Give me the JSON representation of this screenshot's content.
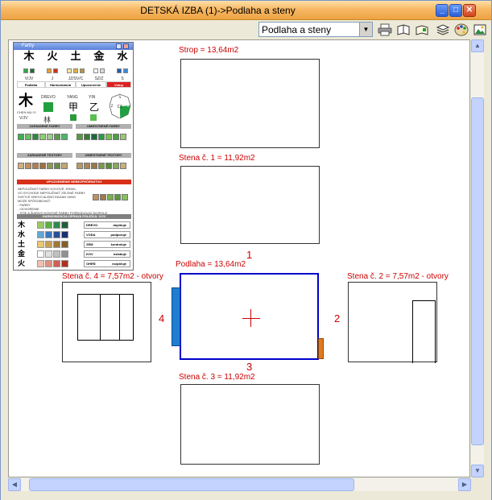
{
  "window": {
    "title": "DETSKÁ IZBA (1)->Podlaha a steny"
  },
  "toolbar": {
    "view_select": "Podlaha a steny",
    "icons": [
      "printer-icon",
      "book-icon",
      "book-open-icon",
      "layers-icon",
      "palette-icon",
      "image-icon"
    ]
  },
  "plan": {
    "strop_label": "Strop = 13,64m2",
    "stena1_label": "Stena č. 1 = 11,92m2",
    "podlaha_label": "Podlaha = 13,64m2",
    "stena4_label": "Stena č. 4 = 7,57m2 - otvory",
    "stena2_label": "Stena č. 2 = 7,57m2 - otvory",
    "stena3_label": "Stena č. 3 = 11,92m2",
    "num1": "1",
    "num2": "2",
    "num3": "3",
    "num4": "4",
    "floor_border_color": "#0000cc",
    "wall4_fill": "#1e7fd0",
    "wall2_fill": "#e07a20"
  },
  "palette": {
    "title": "Farby",
    "elements": [
      {
        "char": "木",
        "dir": "V/JV",
        "colors": [
          "#2ea84a",
          "#1a6e30"
        ]
      },
      {
        "char": "火",
        "dir": "J",
        "colors": [
          "#e8a030",
          "#d03020"
        ]
      },
      {
        "char": "土",
        "dir": "JZ/SV/C",
        "colors": [
          "#f2e8a0",
          "#e0b040",
          "#c09040"
        ]
      },
      {
        "char": "金",
        "dir": "SZ/Z",
        "colors": [
          "#ffffff",
          "#d8d8d8"
        ]
      },
      {
        "char": "水",
        "dir": "S",
        "colors": [
          "#1e5eb0",
          "#3a8ad8"
        ]
      }
    ],
    "tabs": [
      "Podlaha",
      "Harmonizácia",
      "Upozornenie",
      "Vstup"
    ],
    "big_char": "木",
    "big_char_sub": "CHEN MU.YI",
    "drevo": "DREVO",
    "yang": "YANG",
    "yin": "YIN",
    "dir_bottom": "V/JV",
    "compass": [
      "J",
      "JZ",
      "Z",
      "SZ",
      "S",
      "SV",
      "V",
      "JV",
      "C5"
    ],
    "sec_zariadene_farby": "ZARIADENÉ FARBY",
    "sec_umiestnene_farby": "UMIESTNENÉ FARBY",
    "sec_zariadene_textury": "ZARIADENÉ TEXTÚRY",
    "sec_umiestnene_textury": "UMIESTNENÉ TEXTÚRY",
    "sec_upozornenie": "UPOZORNENIE NEBEZPEČENSTVO",
    "warn_lines": [
      "NEPOUŽÍVAŤ FARBY KOVOVÉ, KRAKL",
      "VO SYCHODE NEPOUŽÍVAŤ ZELENÉ FARBY",
      "SVETLÉ DREVO ALEBO RADAN YANG",
      "MOŽE SPÔSOBOVAŤ:",
      " - FARBY",
      " - OCHORENIE",
      " - STIE A ŽIARIVO KOVOVÉ FARBY POŠKODZUJÚ DIOPOLE"
    ],
    "sec_harmonizacia": "HARMONIZÁCIA ÚPRAVA POLIČKA: V/JV",
    "harm_rows": [
      {
        "char": "木",
        "name": "DREVO",
        "action": "doplňuje",
        "colors": [
          "#9cc860",
          "#5ab040",
          "#2e8a4a",
          "#1e5e38"
        ]
      },
      {
        "char": "水",
        "name": "VODA",
        "action": "podporuje",
        "colors": [
          "#60a8d8",
          "#3a78c0",
          "#2a5098",
          "#1a3070"
        ]
      },
      {
        "char": "土",
        "name": "ZEM",
        "action": "kontroluje",
        "colors": [
          "#e8c870",
          "#c8a050",
          "#a07838",
          "#806028"
        ]
      },
      {
        "char": "金",
        "name": "KOV",
        "action": "oslabuje",
        "colors": [
          "#ffffff",
          "#e0e0e0",
          "#c0c0c0",
          "#909090"
        ]
      },
      {
        "char": "火",
        "name": "OHEŇ",
        "action": "rozpaľuje",
        "colors": [
          "#f0c0b0",
          "#e09080",
          "#d06050",
          "#b03020"
        ]
      }
    ]
  }
}
